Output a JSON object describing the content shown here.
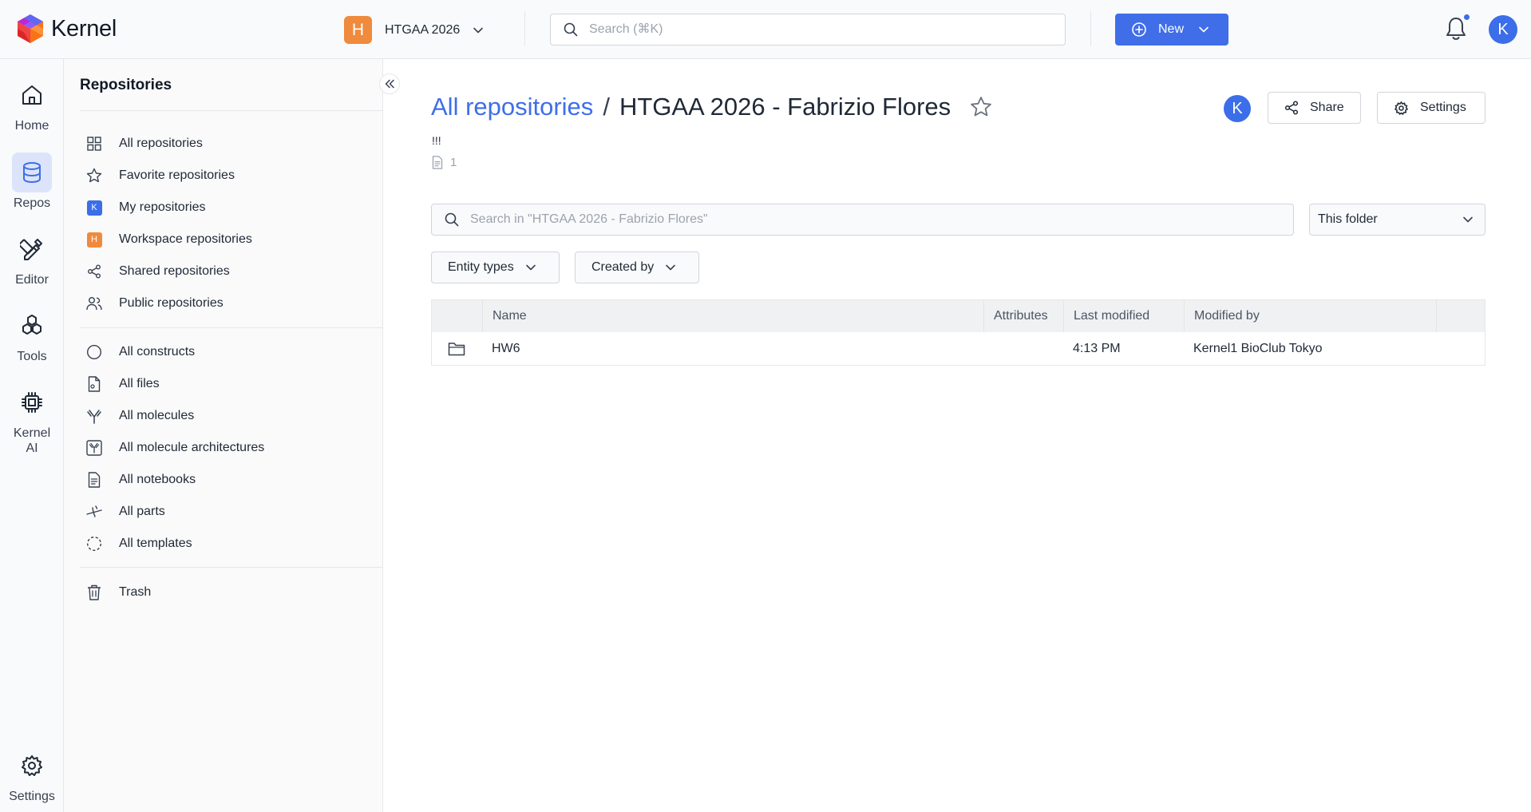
{
  "app": {
    "name": "Kernel",
    "colors": {
      "accent": "#3f6ee8",
      "workspace_badge": "#f08a3c",
      "active_rail": "#dbe4fb"
    }
  },
  "topbar": {
    "workspace": {
      "initial": "H",
      "name": "HTGAA 2026"
    },
    "search_placeholder": "Search (⌘K)",
    "new_button": "New",
    "user_initial": "K"
  },
  "rail": {
    "items": [
      {
        "label": "Home",
        "icon": "home-icon"
      },
      {
        "label": "Repos",
        "icon": "database-icon"
      },
      {
        "label": "Editor",
        "icon": "editor-tools-icon"
      },
      {
        "label": "Tools",
        "icon": "hexagons-icon"
      },
      {
        "label": "Kernel AI",
        "icon": "chip-icon"
      },
      {
        "label": "Settings",
        "icon": "gear-icon"
      }
    ]
  },
  "sidebar": {
    "title": "Repositories",
    "items": [
      {
        "label": "All repositories",
        "icon": "grid-icon"
      },
      {
        "label": "Favorite repositories",
        "icon": "star-icon"
      },
      {
        "label": "My repositories",
        "icon": "user-badge-icon",
        "badge": "K"
      },
      {
        "label": "Workspace repositories",
        "icon": "workspace-badge-icon",
        "badge": "H"
      },
      {
        "label": "Shared repositories",
        "icon": "share-icon"
      },
      {
        "label": "Public repositories",
        "icon": "users-icon"
      },
      {
        "label": "All constructs",
        "icon": "circle-icon"
      },
      {
        "label": "All files",
        "icon": "file-icon"
      },
      {
        "label": "All molecules",
        "icon": "antibody-icon"
      },
      {
        "label": "All molecule architectures",
        "icon": "antibody-box-icon"
      },
      {
        "label": "All notebooks",
        "icon": "notebook-icon"
      },
      {
        "label": "All parts",
        "icon": "parts-icon"
      },
      {
        "label": "All templates",
        "icon": "dashed-circle-icon"
      },
      {
        "label": "Trash",
        "icon": "trash-icon"
      }
    ]
  },
  "main": {
    "breadcrumb": {
      "link": "All repositories",
      "separator": "/",
      "current": "HTGAA 2026 - Fabrizio Flores"
    },
    "description": "!!!",
    "file_count": "1",
    "owner_initial": "K",
    "share_label": "Share",
    "settings_label": "Settings",
    "search_placeholder": "Search in \"HTGAA 2026 - Fabrizio Flores\"",
    "scope_select": "This folder",
    "filters": {
      "entity_types": "Entity types",
      "created_by": "Created by"
    },
    "table": {
      "columns": [
        "Name",
        "Attributes",
        "Last modified",
        "Modified by"
      ],
      "rows": [
        {
          "icon": "folder-icon",
          "name": "HW6",
          "attributes": "",
          "last_modified": "4:13 PM",
          "modified_by": "Kernel1 BioClub Tokyo"
        }
      ]
    }
  }
}
